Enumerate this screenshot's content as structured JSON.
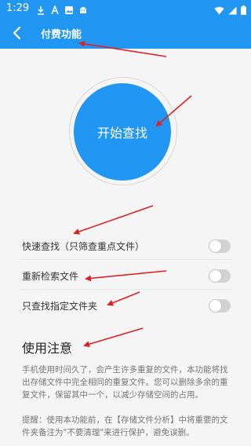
{
  "status_bar": {
    "time": "1:29",
    "icons": [
      "download-icon",
      "font-icon",
      "image-icon",
      "android-icon"
    ],
    "right_icons": [
      "wifi-icon",
      "signal-icon",
      "battery-icon"
    ]
  },
  "header": {
    "title": "付费功能"
  },
  "main": {
    "start_button_label": "开始查找"
  },
  "settings": [
    {
      "label": "快速查找（只筛查重点文件）",
      "enabled": false
    },
    {
      "label": "重新检索文件",
      "enabled": false
    },
    {
      "label": "只查找指定文件夹",
      "enabled": false
    }
  ],
  "notes": {
    "title": "使用注意",
    "paragraph1": "手机使用时间久了，会产生许多重复的文件，本功能将找出存储文件中完全相同的重复文件。您可以删除多余的重复文件，保留其中一个，以减少存储空间的占用。",
    "paragraph2": "提醒：使用本功能前，在【存储文件分析】中将重要的文件夹备注为\"不要清理\"来进行保护，避免误删。"
  },
  "colors": {
    "accent": "#2196f3",
    "annotation_arrow": "#e0201f"
  }
}
